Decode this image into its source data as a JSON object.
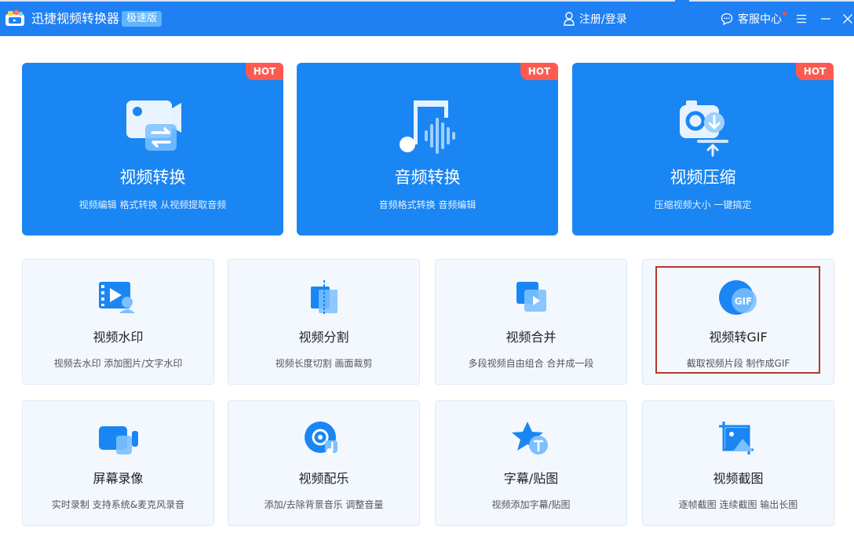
{
  "app": {
    "title": "迅捷视频转换器",
    "edition": "极速版",
    "login_label": "注册/登录",
    "support_label": "客服中心"
  },
  "colors": {
    "titlebar": "#1f80f4",
    "card_blue": "#1a86f3",
    "hot": "#ff5a4f",
    "tool_bg": "#f3f8fe",
    "highlight": "#b03a2e"
  },
  "features": [
    {
      "title": "视频转换",
      "subtitle": "视频编辑 格式转换 从视频提取音频",
      "badge": "HOT",
      "icon": "video-convert-icon"
    },
    {
      "title": "音频转换",
      "subtitle": "音频格式转换 音频编辑",
      "badge": "HOT",
      "icon": "audio-convert-icon"
    },
    {
      "title": "视频压缩",
      "subtitle": "压缩视频大小 一键搞定",
      "badge": "HOT",
      "icon": "video-compress-icon"
    }
  ],
  "tools": [
    {
      "title": "视频水印",
      "subtitle": "视频去水印 添加图片/文字水印",
      "icon": "watermark-icon"
    },
    {
      "title": "视频分割",
      "subtitle": "视频长度切割 画面裁剪",
      "icon": "split-icon"
    },
    {
      "title": "视频合并",
      "subtitle": "多段视频自由组合 合并成一段",
      "icon": "merge-icon"
    },
    {
      "title": "视频转GIF",
      "subtitle": "截取视频片段 制作成GIF",
      "icon": "gif-icon",
      "icon_text": "GIF"
    },
    {
      "title": "屏幕录像",
      "subtitle": "实时录制 支持系统&麦克风录音",
      "icon": "screen-record-icon"
    },
    {
      "title": "视频配乐",
      "subtitle": "添加/去除背景音乐 调整音量",
      "icon": "music-icon"
    },
    {
      "title": "字幕/贴图",
      "subtitle": "视频添加字幕/贴图",
      "icon": "subtitle-icon"
    },
    {
      "title": "视频截图",
      "subtitle": "逐帧截图 连续截图 输出长图",
      "icon": "screenshot-icon"
    }
  ]
}
